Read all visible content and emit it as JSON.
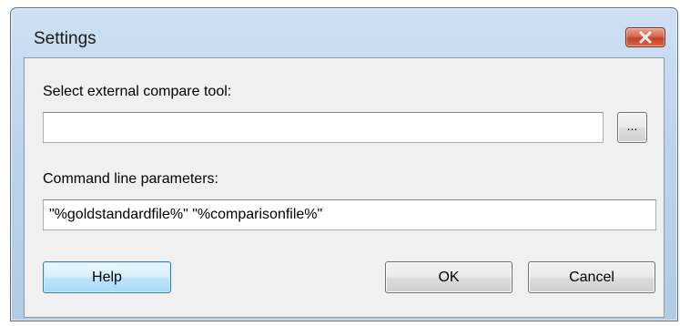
{
  "window": {
    "title": "Settings"
  },
  "compare_tool": {
    "label": "Select external compare tool:",
    "value": "",
    "browse_label": "..."
  },
  "command_line": {
    "label": "Command line parameters:",
    "value": "\"%goldstandardfile%\" \"%comparisonfile%\""
  },
  "buttons": {
    "help": "Help",
    "ok": "OK",
    "cancel": "Cancel"
  },
  "icons": {
    "close": "close-icon"
  },
  "colors": {
    "close_button": "#c2402a",
    "frame": "#bcd3ec",
    "client": "#f0f0f0"
  }
}
